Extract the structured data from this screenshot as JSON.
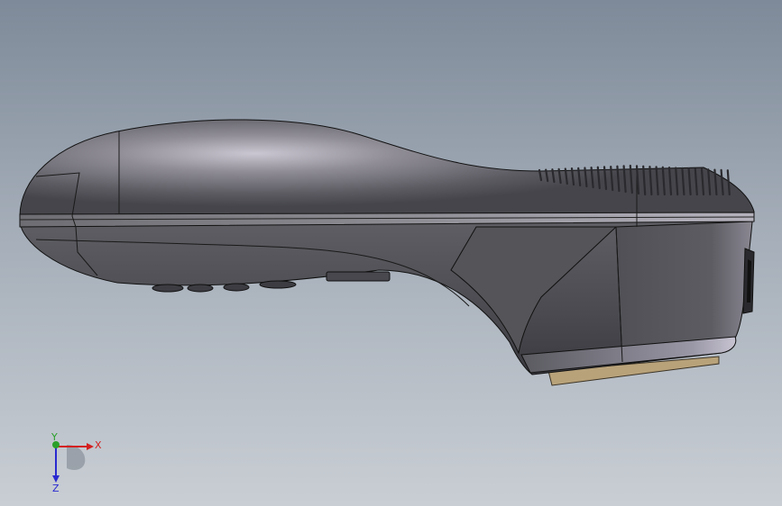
{
  "viewport": {
    "background_top": "#7e8a99",
    "background_bottom": "#c9ced4"
  },
  "model": {
    "body_color": "#5b5b60",
    "highlight_color": "#c9c6cf",
    "base_plate_color": "#b8a27a"
  },
  "triad": {
    "x_label": "X",
    "y_label": "Y",
    "z_label": "Z",
    "x_color": "#d42020",
    "y_color": "#2aa02a",
    "z_color": "#2a2ad0"
  }
}
